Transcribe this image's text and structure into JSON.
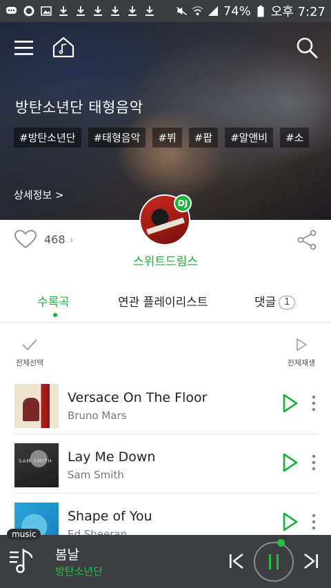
{
  "status_bar": {
    "battery": "74%",
    "time": "오후 7:27",
    "left_icons": [
      "chat-icon",
      "circle-icon",
      "image-icon",
      "download-icon",
      "download-icon",
      "download-icon",
      "download-icon",
      "download-icon",
      "download-icon"
    ],
    "right_icons": [
      "mute-icon",
      "wifi-icon",
      "signal-icon",
      "battery-icon"
    ]
  },
  "header": {
    "playlist_title": "방탄소년단 태형음악",
    "tags": [
      "#방탄소년단",
      "#태형음악",
      "#뷔",
      "#팝",
      "#알앤비",
      "#소"
    ],
    "detail_link": "상세정보 >"
  },
  "dj": {
    "badge": "DJ",
    "name": "스위트드림스"
  },
  "likes": {
    "count": "468",
    "arrow": "›"
  },
  "tabs": [
    {
      "label": "수록곡",
      "active": true
    },
    {
      "label": "연관 플레이리스트",
      "active": false
    },
    {
      "label": "댓글",
      "active": false,
      "badge": "1"
    }
  ],
  "list_controls": {
    "select_all": "전체선택",
    "play_all": "전체재생"
  },
  "tracks": [
    {
      "title": "Versace On The Floor",
      "artist": "Bruno Mars"
    },
    {
      "title": "Lay Me Down",
      "artist": "Sam Smith",
      "cover_text": "SAM SMITH"
    },
    {
      "title": "Shape of You",
      "artist": "Ed Sheeran"
    }
  ],
  "player": {
    "tag": "music",
    "title": "봄날",
    "artist": "방탄소년단",
    "progress": 0.08
  },
  "colors": {
    "accent": "#17b13a",
    "player_bg": "#3c3e41",
    "status_bar_bg": "#3a3c3f"
  }
}
